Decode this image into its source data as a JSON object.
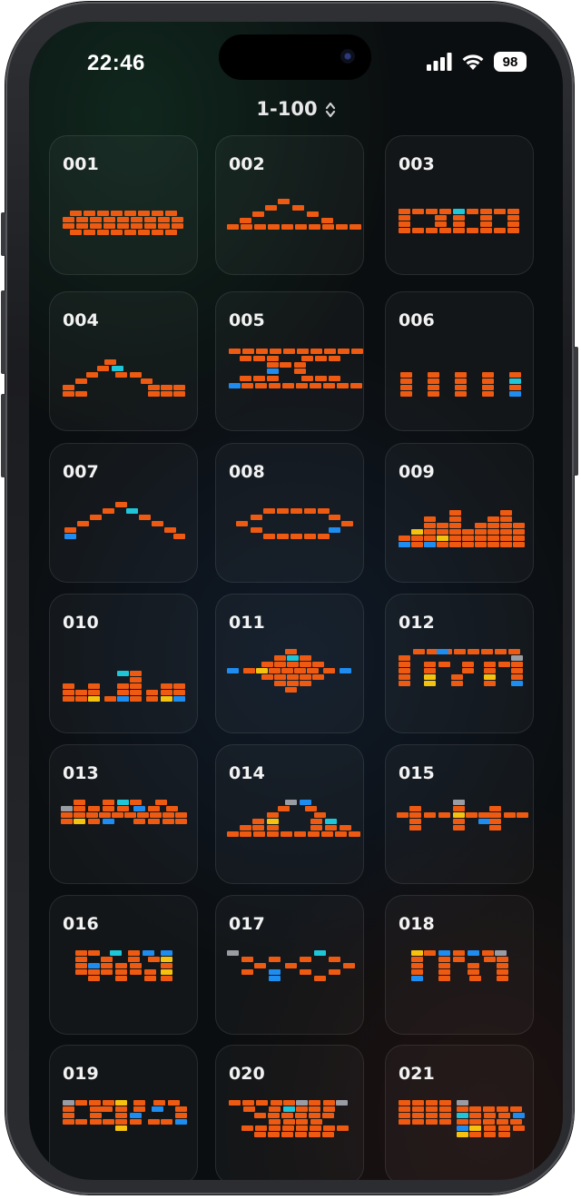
{
  "status_bar": {
    "time": "22:46",
    "battery": "98",
    "icons": [
      "signal-icon",
      "wifi-icon",
      "battery-icon"
    ]
  },
  "header": {
    "range_label": "1-100",
    "range_icon": "chevron-up-down-icon"
  },
  "colors": {
    "orange": "#ee5a11",
    "blue": "#1f8cf0",
    "yellow": "#f5c30f",
    "gray": "#9a9ca3",
    "cyan": "#1ec6d8"
  },
  "levels": [
    {
      "number": "001"
    },
    {
      "number": "002"
    },
    {
      "number": "003"
    },
    {
      "number": "004"
    },
    {
      "number": "005"
    },
    {
      "number": "006"
    },
    {
      "number": "007"
    },
    {
      "number": "008"
    },
    {
      "number": "009"
    },
    {
      "number": "010"
    },
    {
      "number": "011"
    },
    {
      "number": "012"
    },
    {
      "number": "013"
    },
    {
      "number": "014"
    },
    {
      "number": "015"
    },
    {
      "number": "016"
    },
    {
      "number": "017"
    },
    {
      "number": "018"
    },
    {
      "number": "019"
    },
    {
      "number": "020"
    },
    {
      "number": "021"
    }
  ]
}
